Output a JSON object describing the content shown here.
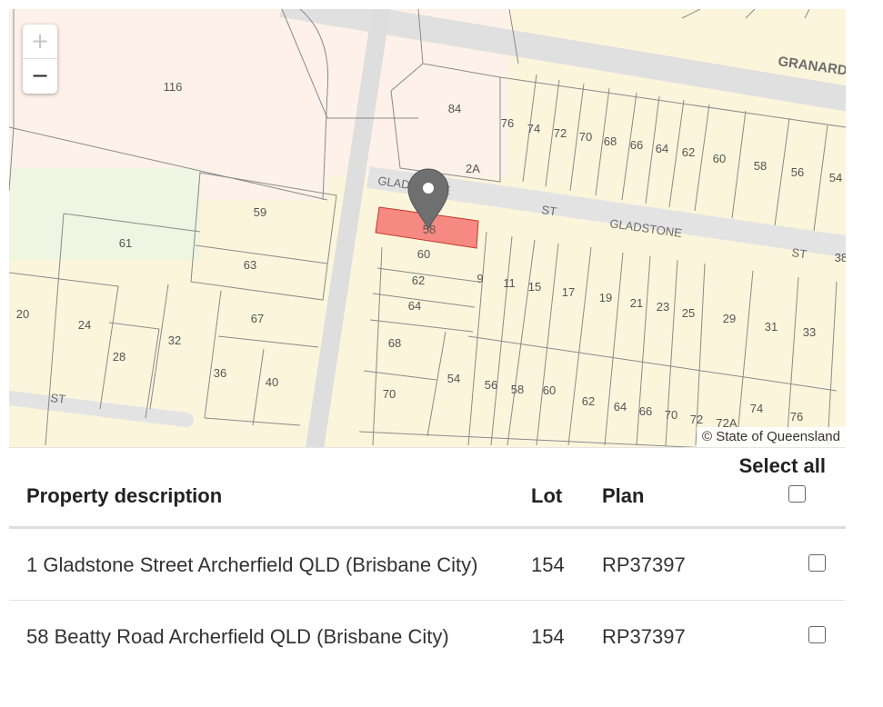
{
  "map": {
    "zoom_in_label": "+",
    "zoom_out_label": "−",
    "attribution": "© State of Queensland",
    "street_labels": [
      "GRANARD",
      "GLADSTONE",
      "GLADSTONE",
      "ST",
      "ST",
      "ST"
    ],
    "lot_numbers": [
      "116",
      "84",
      "2A",
      "76",
      "74",
      "72",
      "70",
      "68",
      "66",
      "64",
      "62",
      "60",
      "58",
      "56",
      "54",
      "59",
      "61",
      "63",
      "58",
      "60",
      "62",
      "64",
      "9",
      "11",
      "15",
      "17",
      "19",
      "21",
      "23",
      "25",
      "29",
      "31",
      "33",
      "38",
      "20",
      "24",
      "28",
      "32",
      "67",
      "36",
      "40",
      "68",
      "70",
      "54",
      "56",
      "58",
      "60",
      "62",
      "64",
      "66",
      "70",
      "72",
      "72A",
      "74",
      "76"
    ],
    "selected_lot": "58",
    "colors": {
      "base": "#fbf5dc",
      "road": "#e3e3e3",
      "parcel_line": "#8a8a8a",
      "selected": "#f68a82",
      "marker": "#6f6f6f"
    }
  },
  "table": {
    "headers": {
      "description": "Property description",
      "lot": "Lot",
      "plan": "Plan",
      "select_all": "Select all"
    },
    "rows": [
      {
        "description": "1 Gladstone Street Archerfield QLD (Brisbane City)",
        "lot": "154",
        "plan": "RP37397",
        "checked": false
      },
      {
        "description": "58 Beatty Road Archerfield QLD (Brisbane City)",
        "lot": "154",
        "plan": "RP37397",
        "checked": false
      }
    ]
  }
}
